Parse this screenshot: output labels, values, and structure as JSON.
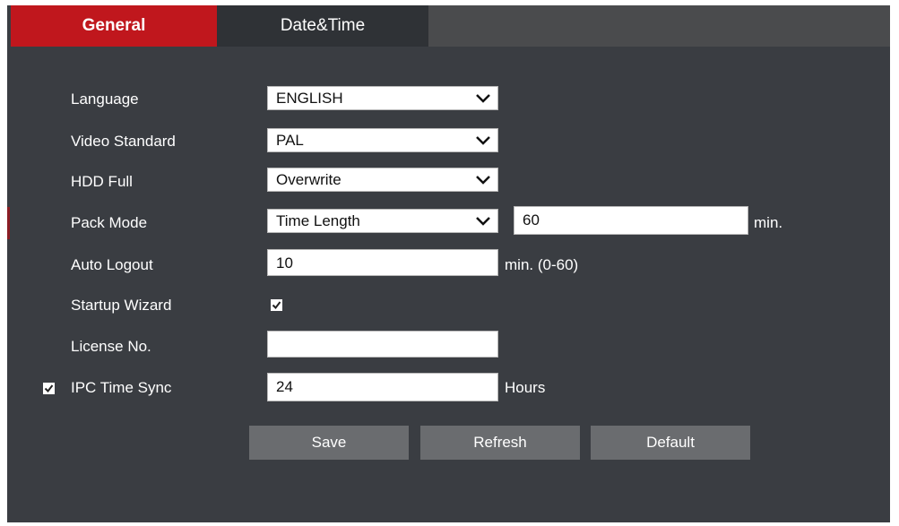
{
  "tabs": [
    {
      "label": "General",
      "active": true
    },
    {
      "label": "Date&Time",
      "active": false
    }
  ],
  "form": {
    "language": {
      "label": "Language",
      "value": "ENGLISH"
    },
    "video_standard": {
      "label": "Video Standard",
      "value": "PAL"
    },
    "hdd_full": {
      "label": "HDD Full",
      "value": "Overwrite"
    },
    "pack_mode": {
      "label": "Pack Mode",
      "value": "Time Length",
      "length_value": "60",
      "unit": "min."
    },
    "auto_logout": {
      "label": "Auto Logout",
      "value": "10",
      "unit": "min. (0-60)"
    },
    "startup_wizard": {
      "label": "Startup Wizard",
      "checked": true
    },
    "license_no": {
      "label": "License No.",
      "value": ""
    },
    "ipc_time_sync": {
      "label": "IPC Time Sync",
      "checked": true,
      "value": "24",
      "unit": "Hours"
    }
  },
  "buttons": {
    "save": "Save",
    "refresh": "Refresh",
    "default": "Default"
  },
  "colors": {
    "panel_bg": "#3a3d42",
    "active_tab": "#c0171d",
    "button_bg": "#6a6c6f"
  },
  "icons": {
    "dropdown": "chevron-down-icon",
    "check": "checkmark-icon"
  }
}
